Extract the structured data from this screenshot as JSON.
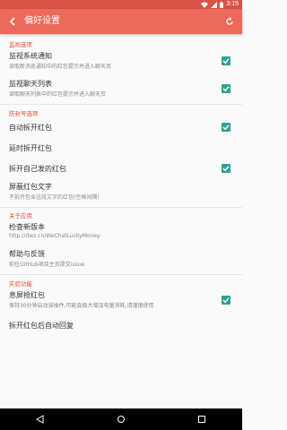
{
  "status_bar": {
    "time": "3:15",
    "icons": [
      "wifi-icon",
      "signal-icon",
      "battery-icon"
    ]
  },
  "app_bar": {
    "title": "偏好设置",
    "back_icon": "back-arrow-icon",
    "action_icon": "refresh-icon"
  },
  "sections": [
    {
      "title": "监视选项",
      "items": [
        {
          "title": "监视系统通知",
          "summary": "读取新消息通知中的红包提示并进入聊天页",
          "checked": true
        },
        {
          "title": "监视聊天列表",
          "summary": "读取聊天列表中的红包提示并进入聊天页",
          "checked": true
        }
      ]
    },
    {
      "title": "防封号选项",
      "items": [
        {
          "title": "自动拆开红包",
          "checked": true
        },
        {
          "title": "延时拆开红包"
        },
        {
          "title": "拆开自己发的红包",
          "checked": true
        },
        {
          "title": "屏蔽红包文字",
          "summary": "不拆开包含这段文字的红包(空格间隔)"
        }
      ]
    },
    {
      "title": "关于应用",
      "items": [
        {
          "title": "检查新版本",
          "summary": "http://dwz.cn/WeChatLuckyMoney"
        },
        {
          "title": "帮助与反馈",
          "summary": "前往GitHub项目主页提交issue"
        }
      ]
    },
    {
      "title": "实验功能",
      "items": [
        {
          "title": "息屏抢红包",
          "summary": "保持30分钟启动该插件,可能会极大增加电量消耗,请谨慎使用",
          "checked": true
        },
        {
          "title": "拆开红包后自动回复"
        }
      ]
    }
  ],
  "nav_bar": {
    "back": "nav-back-icon",
    "home": "nav-home-icon",
    "recents": "nav-recents-icon"
  },
  "colors": {
    "accent": "#ec6a5a",
    "status_bar": "#d9534a",
    "checkbox": "#2fa296",
    "section_title": "#e74c3c"
  }
}
